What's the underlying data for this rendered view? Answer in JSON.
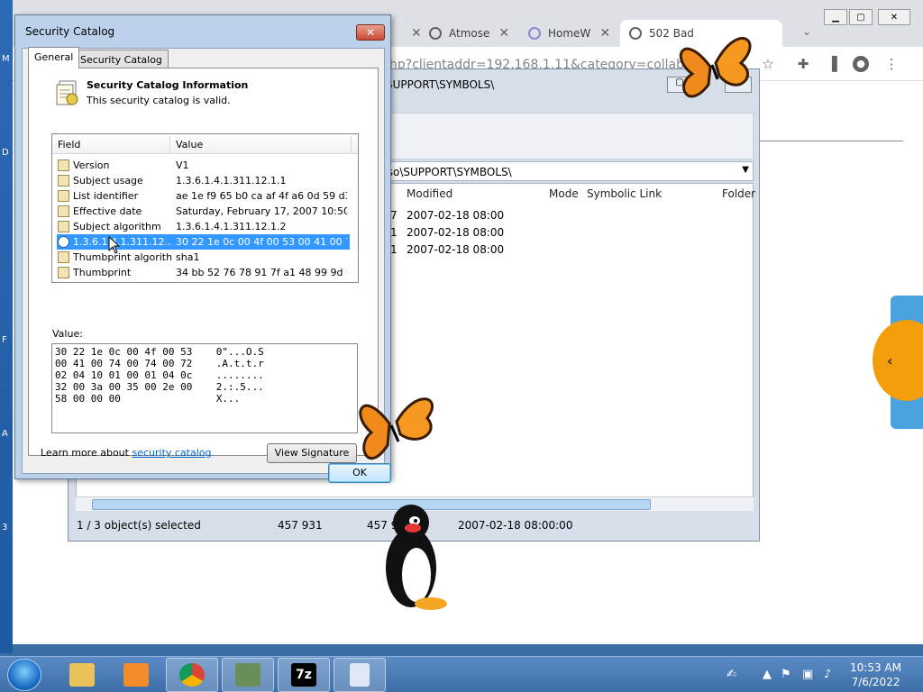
{
  "desktop": {
    "letters": [
      "M",
      "D",
      "F",
      "A",
      "3"
    ]
  },
  "browser": {
    "tabs": [
      {
        "label": "Atmose",
        "icon": "globe-icon"
      },
      {
        "label": "HomeW",
        "icon": "wifi-icon"
      },
      {
        "label": "502 Bad",
        "icon": "globe-icon"
      }
    ],
    "url_fragment": "hp?clientaddr=192.168.1.11&category=collabnet-"
  },
  "zip": {
    "title": "SUPPORT\\SYMBOLS\\",
    "address": "d.iso\\SUPPORT\\SYMBOLS\\",
    "columns": [
      "Modified",
      "Mode",
      "Symbolic Link",
      "Folder"
    ],
    "rows": [
      {
        "prefix": "7",
        "modified": "2007-02-18 08:00"
      },
      {
        "prefix": "1",
        "modified": "2007-02-18 08:00"
      },
      {
        "prefix": "1",
        "modified": "2007-02-18 08:00"
      }
    ],
    "status": {
      "selected": "1 / 3 object(s) selected",
      "size": "457 931",
      "packed": "457 9",
      "date": "2007-02-18 08:00:00"
    }
  },
  "dialog": {
    "title": "Security Catalog",
    "tabs": [
      "General",
      "Security Catalog"
    ],
    "heading": "Security Catalog Information",
    "status": "This security catalog is valid.",
    "columns": {
      "field": "Field",
      "value": "Value"
    },
    "fields": [
      {
        "name": "Version",
        "value": "V1"
      },
      {
        "name": "Subject usage",
        "value": "1.3.6.1.4.1.311.12.1.1"
      },
      {
        "name": "List identifier",
        "value": "ae 1e f9 65 b0 ca af 4f a6 0d 59 d3 ..."
      },
      {
        "name": "Effective date",
        "value": "Saturday, February 17, 2007 10:50:..."
      },
      {
        "name": "Subject algorithm",
        "value": "1.3.6.1.4.1.311.12.1.2"
      },
      {
        "name": "1.3.6.1.4.1.311.12...",
        "value": "30 22 1e 0c 00 4f 00 53 00 41 00 74..."
      },
      {
        "name": "Thumbprint algorithm",
        "value": "sha1"
      },
      {
        "name": "Thumbprint",
        "value": "34 bb 52 76 78 91 7f a1 48 99 9d 65..."
      }
    ],
    "value_label": "Value:",
    "value_lines": [
      "30 22 1e 0c 00 4f 00 53    0\"...O.S",
      "00 41 00 74 00 74 00 72    .A.t.t.r",
      "02 04 10 01 00 01 04 0c    ........",
      "32 00 3a 00 35 00 2e 00    2.:.5...",
      "58 00 00 00                X..."
    ],
    "learn_prefix": "Learn more about ",
    "learn_link": "security catalog",
    "view_signature": "View Signature",
    "ok": "OK"
  },
  "taskbar": {
    "clock_time": "10:53 AM",
    "clock_date": "7/6/2022",
    "zip_label": "7z"
  }
}
